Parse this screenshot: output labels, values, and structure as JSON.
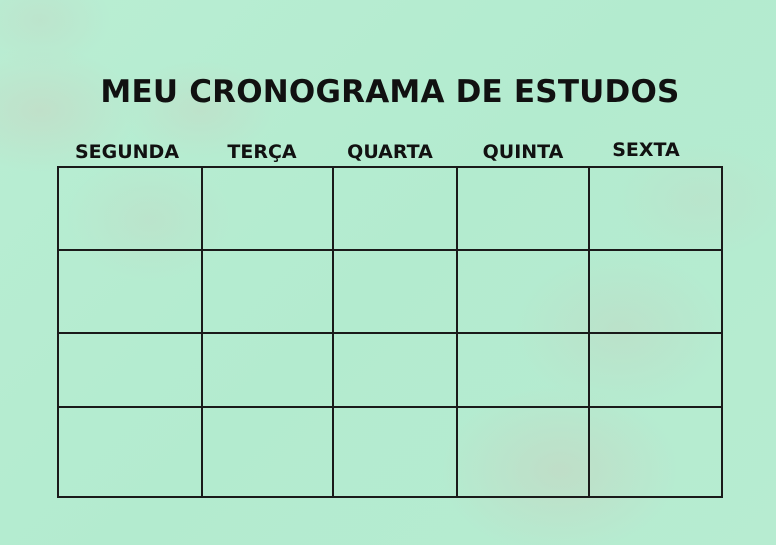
{
  "title": "MEU CRONOGRAMA DE ESTUDOS",
  "days": [
    "SEGUNDA",
    "TERÇA",
    "QUARTA",
    "QUINTA",
    "SEXTA"
  ],
  "colors": {
    "background": "#b6ecd0",
    "text": "#111111",
    "grid_line": "#1a1a1a"
  }
}
